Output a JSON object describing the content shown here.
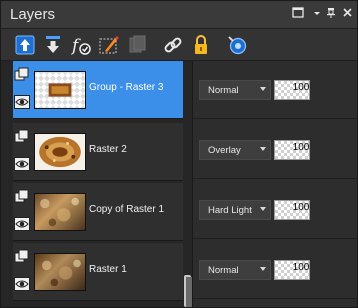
{
  "panel": {
    "title": "Layers"
  },
  "title_controls": [
    {
      "name": "maximize-icon",
      "glyph": "☐"
    },
    {
      "name": "menu-dropdown-icon",
      "glyph": "▾"
    },
    {
      "name": "pin-icon",
      "glyph": "⊥"
    },
    {
      "name": "close-icon",
      "glyph": "✕"
    }
  ],
  "toolbar": {
    "tools": [
      {
        "name": "new-raster-layer-icon"
      },
      {
        "name": "merge-down-icon"
      },
      {
        "name": "layer-effects-icon"
      },
      {
        "name": "layer-style-icon"
      },
      {
        "name": "disabled-layer-icon"
      },
      {
        "name": "link-icon"
      },
      {
        "name": "lock-icon"
      },
      {
        "name": "visibility-toggle-icon"
      }
    ]
  },
  "layers": [
    {
      "name": "Group - Raster 3",
      "blend_mode": "Normal",
      "opacity": "100",
      "selected": true
    },
    {
      "name": "Raster 2",
      "blend_mode": "Overlay",
      "opacity": "100",
      "selected": false
    },
    {
      "name": "Copy of Raster 1",
      "blend_mode": "Hard Light",
      "opacity": "100",
      "selected": false
    },
    {
      "name": "Raster 1",
      "blend_mode": "Normal",
      "opacity": "100",
      "selected": false
    }
  ],
  "colors": {
    "selection": "#3b8fe8",
    "panel_bg": "#2d2d2d"
  }
}
